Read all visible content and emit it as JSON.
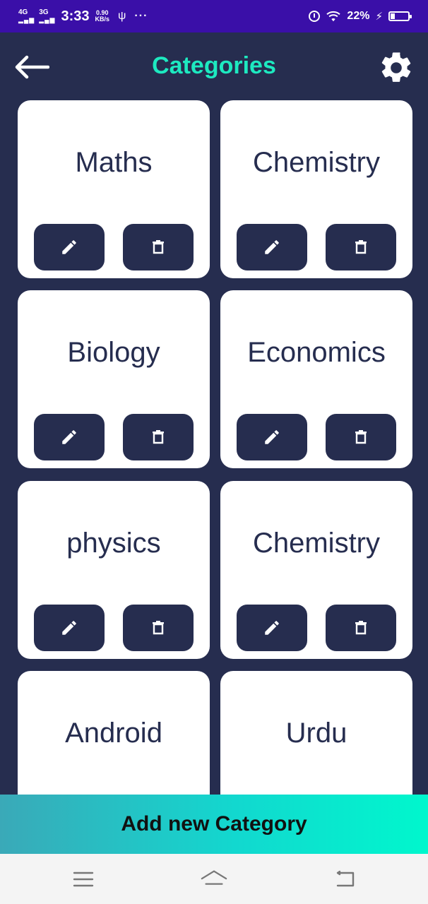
{
  "status_bar": {
    "net1": "4G",
    "net2": "3G",
    "time": "3:33",
    "speed_value": "0.90",
    "speed_unit": "KB/s",
    "battery": "22%"
  },
  "header": {
    "title": "Categories",
    "back_icon": "arrow-left-icon",
    "settings_icon": "gear-icon"
  },
  "categories": [
    {
      "name": "Maths"
    },
    {
      "name": "Chemistry"
    },
    {
      "name": "Biology"
    },
    {
      "name": "Economics"
    },
    {
      "name": "physics"
    },
    {
      "name": "Chemistry"
    },
    {
      "name": "Android"
    },
    {
      "name": "Urdu"
    }
  ],
  "card_actions": {
    "edit_icon": "pencil-icon",
    "delete_icon": "trash-icon"
  },
  "add_button": {
    "label": "Add new Category"
  },
  "colors": {
    "background": "#262d4f",
    "status_bar": "#3a0fa8",
    "title_accent": "#1de9c0",
    "card": "#ffffff",
    "cta_gradient_start": "#3aa9b8",
    "cta_gradient_end": "#00f7cd"
  },
  "nav_bar": {
    "icons": [
      "menu-icon",
      "home-icon",
      "back-icon"
    ]
  }
}
